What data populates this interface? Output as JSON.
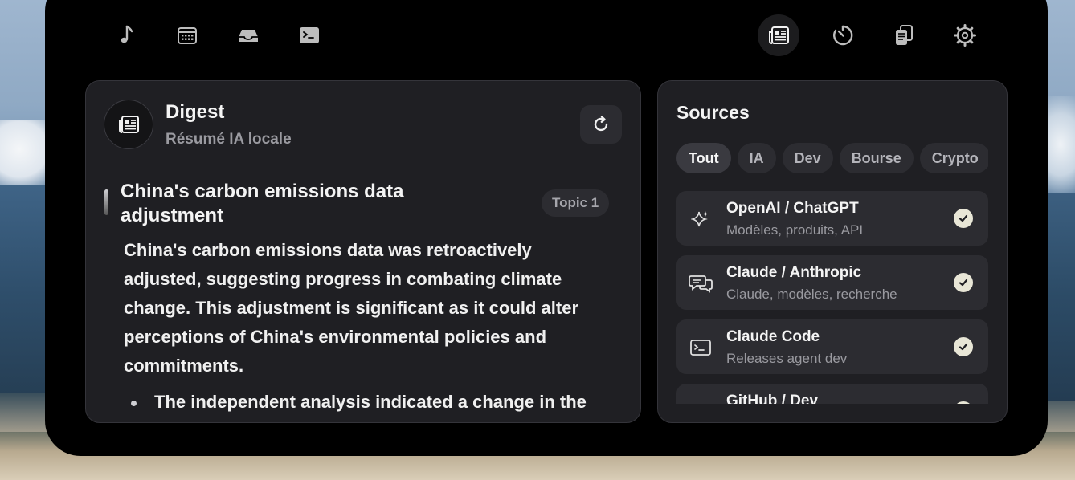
{
  "toolbar": {
    "tabs": [
      {
        "name": "music-icon"
      },
      {
        "name": "calendar-icon"
      },
      {
        "name": "inbox-icon"
      },
      {
        "name": "terminal-icon"
      },
      {
        "name": "newspaper-icon",
        "active": true
      },
      {
        "name": "timer-icon"
      },
      {
        "name": "clipboard-icon"
      },
      {
        "name": "gear-icon"
      }
    ]
  },
  "digest": {
    "title": "Digest",
    "subtitle": "Résumé IA locale",
    "refresh_icon": "refresh-icon",
    "topic_title": "China's carbon emissions data adjustment",
    "topic_badge": "Topic 1",
    "summary": "China's carbon emissions data was retroactively adjusted, suggesting progress in combating climate change. This adjustment is significant as it could alter perceptions of China's environmental policies and commitments.",
    "bullet_1": "The independent analysis indicated a change in the"
  },
  "sources": {
    "title": "Sources",
    "filters": [
      "Tout",
      "IA",
      "Dev",
      "Bourse",
      "Crypto"
    ],
    "active_filter": "Tout",
    "items": [
      {
        "icon": "sparkles-icon",
        "name": "OpenAI / ChatGPT",
        "desc": "Modèles, produits, API",
        "checked": true
      },
      {
        "icon": "chat-bubbles-icon",
        "name": "Claude / Anthropic",
        "desc": "Claude, modèles, recherche",
        "checked": true
      },
      {
        "icon": "terminal-icon",
        "name": "Claude Code",
        "desc": "Releases agent dev",
        "checked": true
      },
      {
        "icon": "sparkles-icon",
        "name": "GitHub / Dev",
        "desc": "",
        "checked": true
      }
    ]
  },
  "colors": {
    "window": "#000000",
    "card": "#1f1f23",
    "chip": "#2c2c31",
    "check": "#e8e6d6"
  }
}
